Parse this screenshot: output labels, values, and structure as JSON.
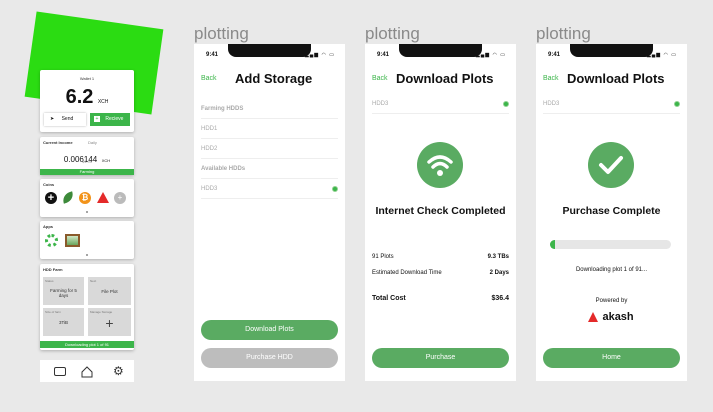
{
  "wallet": {
    "title": "Wallet 1",
    "balance": "6.2",
    "unit": "XCH",
    "send_label": "Send",
    "receive_label": "Recieve"
  },
  "income": {
    "title": "Current Income",
    "selector": "Daily",
    "value": "0.006144",
    "unit": "XCH",
    "sub": "$1.95",
    "status": "Farming"
  },
  "coins": {
    "title": "Coins",
    "add_symbol": "+"
  },
  "apps": {
    "title": "Apps"
  },
  "hdd_farm": {
    "title": "HDD Farm",
    "cells": [
      {
        "label": "Status",
        "value": "Farming for 5 days"
      },
      {
        "label": "Next",
        "value": "File Plot"
      },
      {
        "label": "Size of farm",
        "value": "3TiB"
      },
      {
        "label": "Manage Storage",
        "value": "+"
      }
    ],
    "progress": "Downloading plot 1 of 91"
  },
  "screen_title": "plotting",
  "status_time": "9:41",
  "screens": {
    "storage": {
      "back": "Back",
      "title": "Add Storage",
      "items": [
        "Farming HDDS",
        "HDD1",
        "HDD2",
        "Available HDDs",
        "HDD3"
      ],
      "primary_btn": "Download Plots",
      "secondary_btn": "Purchase HDD"
    },
    "download": {
      "back": "Back",
      "title": "Download Plots",
      "drive": "HDD3",
      "headline": "Internet Check Completed",
      "rows": [
        {
          "label": "91 Plots",
          "value": "9.3 TBs"
        },
        {
          "label": "Estimated Download Time",
          "value": "2 Days"
        }
      ],
      "total_label": "Total Cost",
      "total_value": "$36.4",
      "button": "Purchase"
    },
    "complete": {
      "back": "Back",
      "title": "Download Plots",
      "drive": "HDD3",
      "headline": "Purchase Complete",
      "progress_fraction": 0.04,
      "progress_text": "Downloading plot 1 of 91...",
      "powered_by": "Powered by",
      "brand": "akash",
      "button": "Home"
    }
  },
  "colors": {
    "accent": "#3cb54a",
    "button": "#5aab62",
    "disabled": "#bdbdbd"
  }
}
